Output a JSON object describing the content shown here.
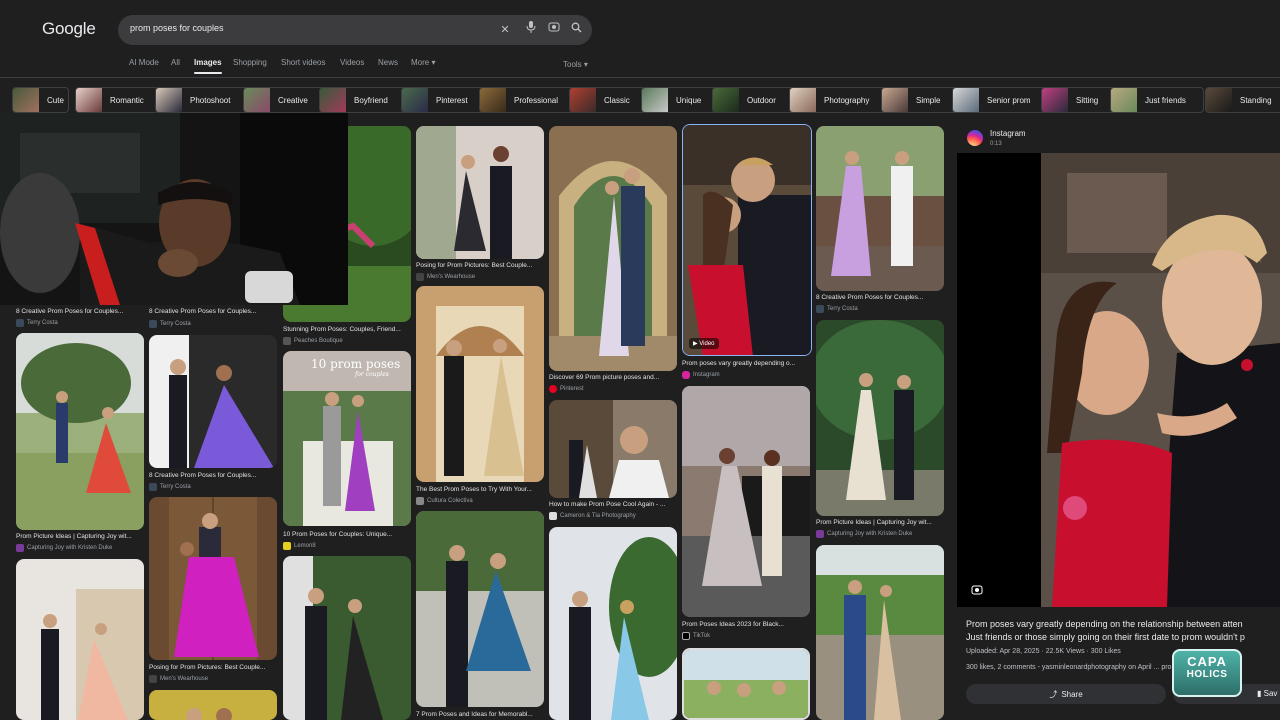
{
  "header": {
    "logo": "Google",
    "query": "prom poses for couples",
    "tabs": [
      "AI Mode",
      "All",
      "Images",
      "Shopping",
      "Short videos",
      "Videos",
      "News",
      "More ▾"
    ],
    "tools": "Tools ▾"
  },
  "chips": [
    "Cute",
    "Romantic",
    "Photoshoot",
    "Creative",
    "Boyfriend",
    "Pinterest",
    "Professional",
    "Classic",
    "Unique",
    "Outdoor",
    "Photography",
    "Simple",
    "Senior prom",
    "Sitting",
    "Just friends",
    "Standing"
  ],
  "results": [
    {
      "caption": "8 Creative Prom Poses for Couples...",
      "source": "Terry Costa"
    },
    {
      "caption": "8 Creative Prom Poses for Couples...",
      "source": "Terry Costa"
    },
    {
      "caption": "Stunning Prom Poses: Couples, Friend...",
      "source": "Peaches Boutique"
    },
    {
      "caption": "Posing for Prom Pictures: Best Couple...",
      "source": "Men's Wearhouse"
    },
    {
      "caption": "Discover 69 Prom picture poses and...",
      "source": "Pinterest"
    },
    {
      "caption": "Prom poses vary greatly depending o...",
      "source": "Instagram"
    },
    {
      "caption": "8 Creative Prom Poses for Couples...",
      "source": "Terry Costa"
    },
    {
      "caption": "Prom Picture Ideas | Capturing Joy wit...",
      "source": "Capturing Joy with Kristen Duke"
    },
    {
      "caption": "8 Creative Prom Poses for Couples...",
      "source": "Terry Costa"
    },
    {
      "caption": "10 Prom Poses for Couples: Unique...",
      "source": "Lemon8"
    },
    {
      "caption": "The Best Prom Poses to Try With Your...",
      "source": "Cultura Colectiva"
    },
    {
      "caption": "How to make Prom Pose Cool Again - ...",
      "source": "Cameron & Tia Photography"
    },
    {
      "caption": "Prom Poses Ideas 2023 for Black...",
      "source": "TikTok"
    },
    {
      "caption": "Prom Picture Ideas | Capturing Joy wit...",
      "source": "Capturing Joy with Kristen Duke"
    },
    {
      "caption": "Posing for Prom Pictures: Best Couple...",
      "source": "Men's Wearhouse"
    },
    {
      "caption": "7 Prom Poses and Ideas for Memorabl...",
      "source": ""
    }
  ],
  "overlay_text": {
    "ten_prom": "10 prom poses",
    "for_couples": "for couples",
    "video": "Video"
  },
  "panel": {
    "source": "Instagram",
    "duration": "0:13",
    "desc_line1": "Prom poses vary greatly depending on the relationship between atten",
    "desc_line2": "Just friends or those simply going on their first date to prom wouldn't p",
    "meta1": "Uploaded: Apr 28, 2025 · 22.5K Views · 300 Likes",
    "meta2": "300 likes, 2 comments - yasminleonardphotography on April ... prom varygr",
    "share": "Share",
    "save": "Sav"
  },
  "badge": {
    "line1": "CAPA",
    "line2": "HOLICS"
  },
  "colors": {
    "bg": "#1f1f1f",
    "chip_border": "#3c4043",
    "text": "#e8eaed",
    "muted": "#9aa0a6",
    "red_dress": "#c8102e"
  }
}
